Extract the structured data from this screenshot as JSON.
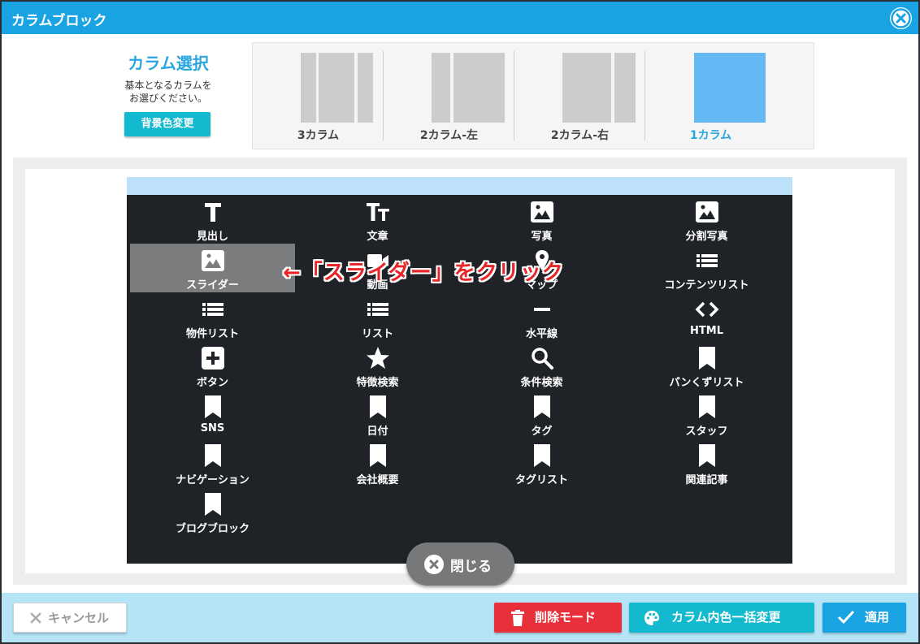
{
  "dialog": {
    "title": "カラムブロック"
  },
  "column_select": {
    "heading": "カラム選択",
    "description_line1": "基本となるカラムを",
    "description_line2": "お選びください。",
    "bg_button": "背景色変更",
    "options": [
      {
        "label": "3カラム",
        "selected": false
      },
      {
        "label": "2カラム-左",
        "selected": false
      },
      {
        "label": "2カラム-右",
        "selected": false
      },
      {
        "label": "1カラム",
        "selected": true
      }
    ]
  },
  "blocks": [
    {
      "label": "見出し",
      "icon": "heading-icon"
    },
    {
      "label": "文章",
      "icon": "text-size-icon"
    },
    {
      "label": "写真",
      "icon": "image-icon"
    },
    {
      "label": "分割写真",
      "icon": "image-icon"
    },
    {
      "label": "スライダー",
      "icon": "image-icon",
      "highlighted": true
    },
    {
      "label": "動画",
      "icon": "video-icon"
    },
    {
      "label": "マップ",
      "icon": "map-pin-icon"
    },
    {
      "label": "コンテンツリスト",
      "icon": "list-icon"
    },
    {
      "label": "物件リスト",
      "icon": "list-icon"
    },
    {
      "label": "リスト",
      "icon": "list-icon"
    },
    {
      "label": "水平線",
      "icon": "horizontal-line-icon"
    },
    {
      "label": "HTML",
      "icon": "code-icon"
    },
    {
      "label": "ボタン",
      "icon": "plus-square-icon"
    },
    {
      "label": "特徴検索",
      "icon": "star-icon"
    },
    {
      "label": "条件検索",
      "icon": "search-icon"
    },
    {
      "label": "パンくずリスト",
      "icon": "bookmark-icon"
    },
    {
      "label": "SNS",
      "icon": "bookmark-icon"
    },
    {
      "label": "日付",
      "icon": "bookmark-icon"
    },
    {
      "label": "タグ",
      "icon": "bookmark-icon"
    },
    {
      "label": "スタッフ",
      "icon": "bookmark-icon"
    },
    {
      "label": "ナビゲーション",
      "icon": "bookmark-icon"
    },
    {
      "label": "会社概要",
      "icon": "bookmark-icon"
    },
    {
      "label": "タグリスト",
      "icon": "bookmark-icon"
    },
    {
      "label": "関連記事",
      "icon": "bookmark-icon"
    },
    {
      "label": "ブログブロック",
      "icon": "bookmark-icon"
    }
  ],
  "annotation": {
    "text": "←「スライダー」をクリック",
    "color": "#e8262a"
  },
  "close_button": {
    "label": "閉じる"
  },
  "footer": {
    "cancel": "キャンセル",
    "delete_mode": "削除モード",
    "bulk_color": "カラム内色一括変更",
    "apply": "適用"
  },
  "colors": {
    "accent": "#1aa3e3",
    "teal": "#13b9cf",
    "danger": "#e8303a",
    "selected_column": "#66b8f5",
    "panel_dark": "#1f2327"
  }
}
